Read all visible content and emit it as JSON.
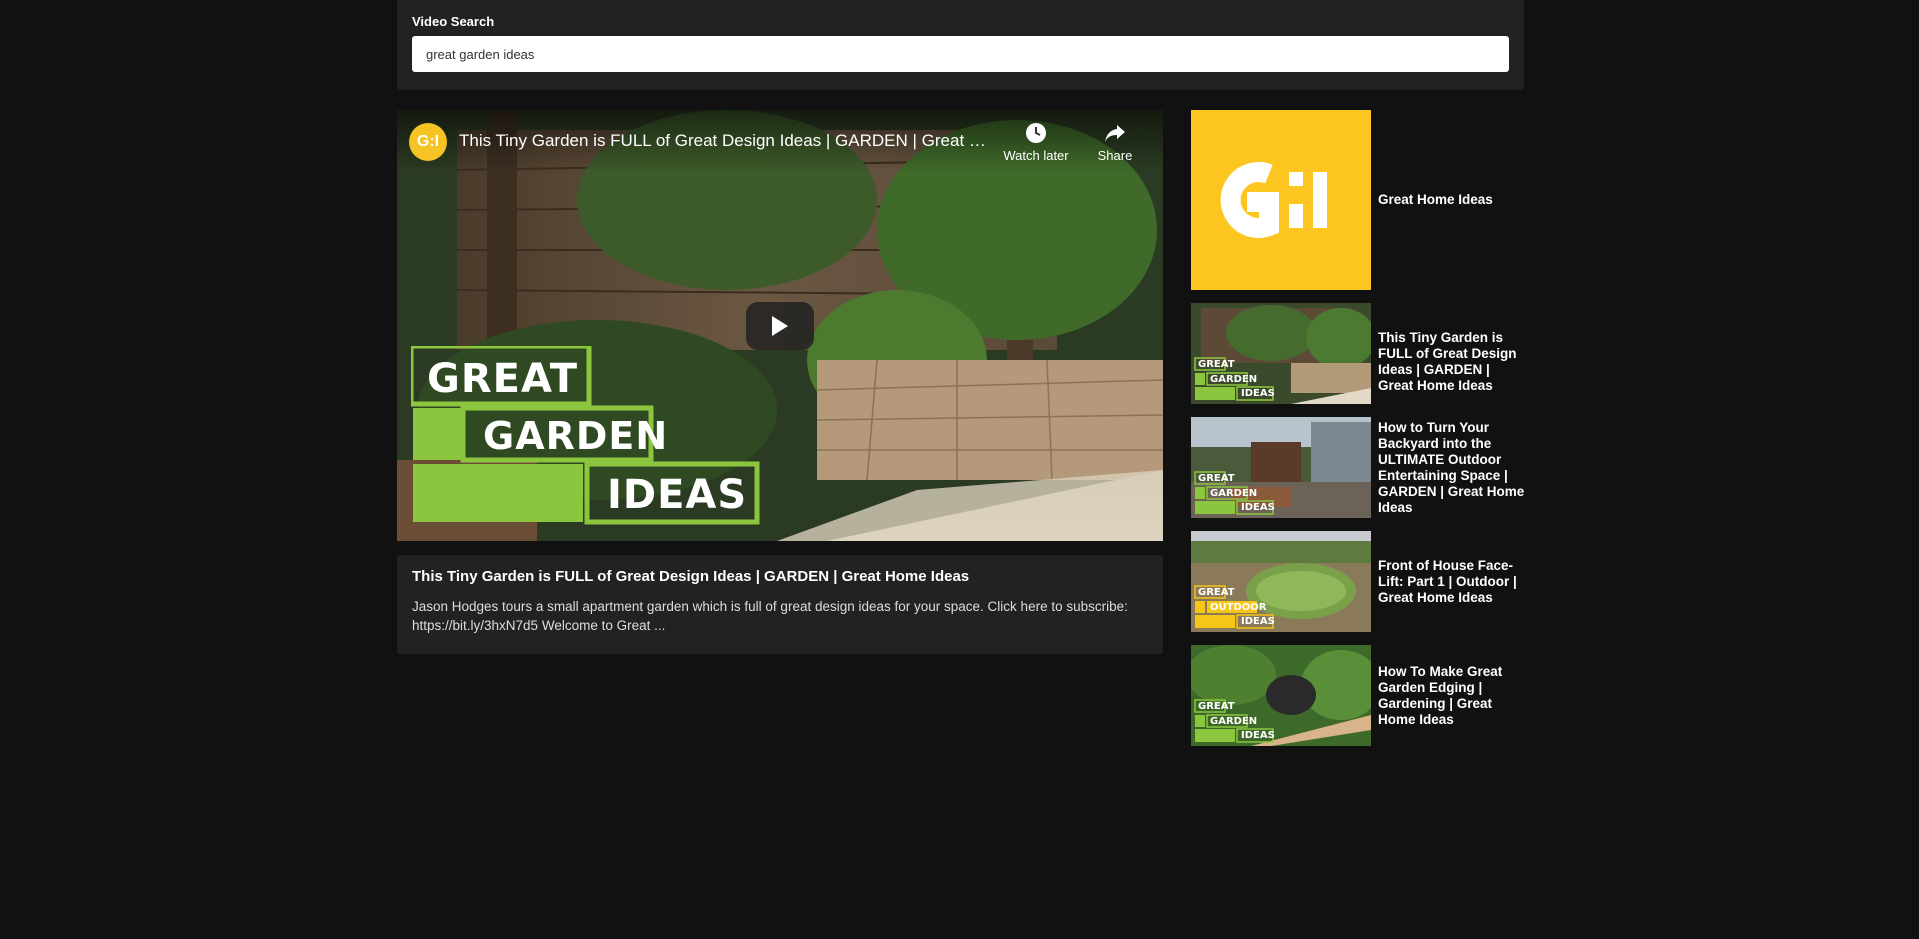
{
  "search": {
    "label": "Video Search",
    "value": "great garden ideas"
  },
  "player": {
    "channel_avatar_text": "G:I",
    "title": "This Tiny Garden is FULL of Great Design Ideas | GARDEN | Great Home Ideas",
    "watch_later_label": "Watch later",
    "share_label": "Share",
    "logo_words": [
      "GREAT",
      "GARDEN",
      "IDEAS"
    ],
    "logo_color": "#8cc63f"
  },
  "video_info": {
    "title": "This Tiny Garden is FULL of Great Design Ideas | GARDEN | Great Home Ideas",
    "description": "Jason Hodges tours a small apartment garden which is full of great design ideas for your space. Click here to subscribe: https://bit.ly/3hxN7d5 Welcome to Great ..."
  },
  "sidebar": {
    "items": [
      {
        "title": "Great Home Ideas",
        "thumb_type": "channel-logo",
        "logo_text": "G:I",
        "thumb_color": "#fcc520"
      },
      {
        "title": "This Tiny Garden is FULL of Great Design Ideas | GARDEN | Great Home Ideas",
        "thumb_type": "garden",
        "labels": [
          "GREAT",
          "GARDEN",
          "IDEAS"
        ]
      },
      {
        "title": "How to Turn Your Backyard into the ULTIMATE Outdoor Entertaining Space | GARDEN | Great Home Ideas",
        "thumb_type": "backyard",
        "labels": [
          "GREAT",
          "GARDEN",
          "IDEAS"
        ]
      },
      {
        "title": "Front of House Face-Lift: Part 1 | Outdoor | Great Home Ideas",
        "thumb_type": "outdoor",
        "labels": [
          "GREAT",
          "OUTDOOR",
          "IDEAS"
        ]
      },
      {
        "title": "How To Make Great Garden Edging | Gardening | Great Home Ideas",
        "thumb_type": "edging",
        "labels": [
          "GREAT",
          "GARDEN",
          "IDEAS"
        ]
      }
    ]
  },
  "colors": {
    "page_bg": "#111111",
    "panel_bg": "#222222",
    "garden_green": "#8cc63f",
    "outdoor_yellow": "#f5c518",
    "brand_yellow": "#fcc520"
  }
}
